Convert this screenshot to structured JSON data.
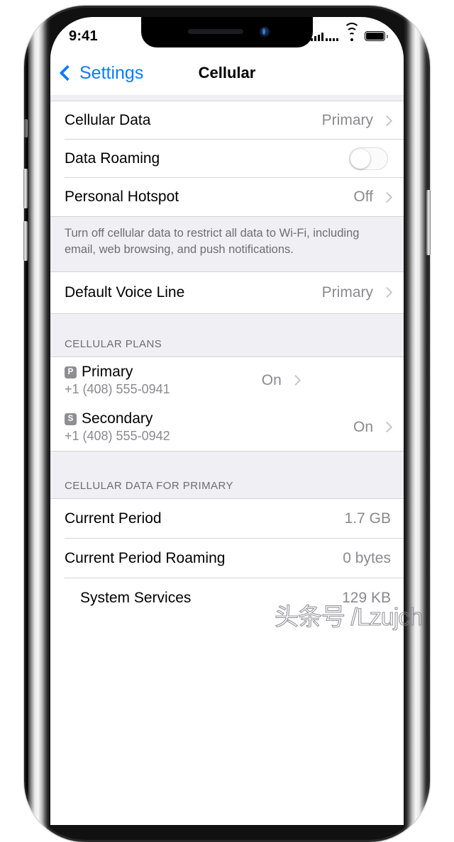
{
  "device": {
    "frame_name": "iphone-frame",
    "notch": {
      "speaker": "earpiece-speaker",
      "camera": "front-camera"
    },
    "buttons": [
      "mute-switch",
      "volume-up",
      "volume-down",
      "power-button"
    ]
  },
  "status_bar": {
    "time": "9:41",
    "signal_icon": "cellular-signal-dual-icon",
    "wifi_icon": "wifi-icon",
    "battery_icon": "battery-full-icon"
  },
  "nav": {
    "back_icon": "chevron-left-icon",
    "back_label": "Settings",
    "title": "Cellular"
  },
  "groups": [
    {
      "rows": [
        {
          "title": "Cellular Data",
          "value": "Primary",
          "chevron": true,
          "control": "none"
        },
        {
          "title": "Data Roaming",
          "value": "",
          "chevron": false,
          "control": "toggle",
          "toggle_on": false
        },
        {
          "title": "Personal Hotspot",
          "value": "Off",
          "chevron": true,
          "control": "none"
        }
      ]
    }
  ],
  "note": "Turn off cellular data to restrict all data to Wi-Fi, including email, web browsing, and push notifications.",
  "voice_group": {
    "rows": [
      {
        "title": "Default Voice Line",
        "value": "Primary",
        "chevron": true
      }
    ]
  },
  "plans_section": {
    "header": "CELLULAR PLANS",
    "plans": [
      {
        "badge": "P",
        "name": "Primary",
        "number": "+1 (408) 555-0941",
        "value": "On",
        "chevron": true
      },
      {
        "badge": "S",
        "name": "Secondary",
        "number": "+1 (408) 555-0942",
        "value": "On",
        "chevron": true
      }
    ]
  },
  "data_section": {
    "header": "CELLULAR DATA FOR PRIMARY",
    "rows": [
      {
        "title": "Current Period",
        "value": "1.7 GB",
        "indent": false
      },
      {
        "title": "Current Period Roaming",
        "value": "0 bytes",
        "indent": false
      },
      {
        "title": "System Services",
        "value": "129 KB",
        "indent": true
      }
    ]
  },
  "watermark": {
    "text": "头条号 /Lzujch"
  },
  "colors": {
    "accent_blue": "#0a7cff",
    "value_gray": "#8a8a8e",
    "section_bg": "#efeff4",
    "separator": "#d3d3d6",
    "badge_gray": "#8e8e93"
  }
}
